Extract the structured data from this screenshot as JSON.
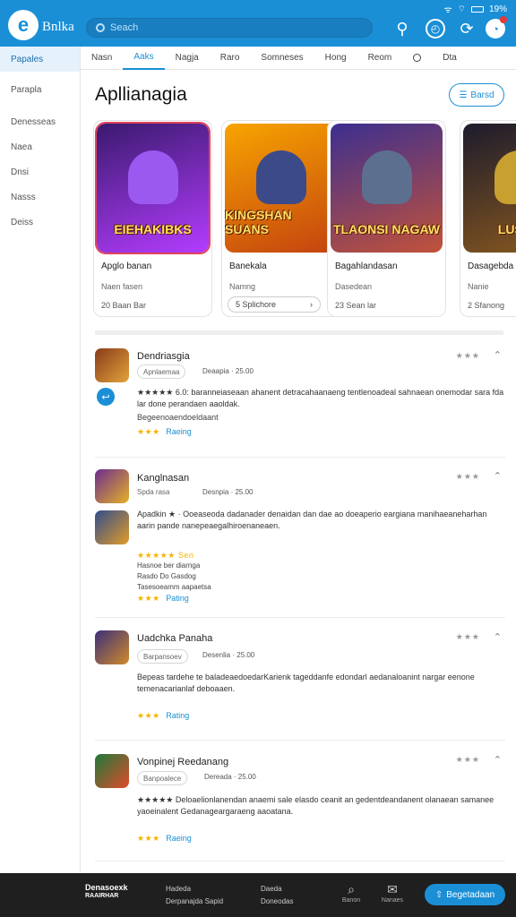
{
  "status_bar": {
    "signal": "ᯤ",
    "wifi": "⌔",
    "battery_text": "19%"
  },
  "header": {
    "brand": "Bnlka",
    "search_placeholder": "Seach"
  },
  "sidebar": {
    "items": [
      {
        "label": "Papales",
        "active": true
      },
      {
        "label": "Parapla",
        "active": false
      },
      {
        "label": "Denesseas",
        "active": false
      },
      {
        "label": "Naea",
        "active": false
      },
      {
        "label": "Dnsi",
        "active": false
      },
      {
        "label": "Nasss",
        "active": false
      },
      {
        "label": "Deiss",
        "active": false
      }
    ]
  },
  "tabs": [
    "Nasn",
    "Aaks",
    "Nagja",
    "Raro",
    "Somneses",
    "Hong",
    "Reom",
    "Dta"
  ],
  "page": {
    "title": "Apllianagia",
    "sort_label": "Barsd"
  },
  "cards": [
    {
      "art_title": "EIEHAKIBKS",
      "name": "Apglo banan",
      "sub": "Naen fasen",
      "price": "20 Baan Bar",
      "colors": [
        "#3a1a6e",
        "#b43cff"
      ],
      "figure": "#9b59f0"
    },
    {
      "art_title": "KINGSHAN SUANS",
      "name": "Banekala",
      "sub": "Namng",
      "price": "5 Splichore",
      "colors": [
        "#f7a400",
        "#c4430f"
      ],
      "figure": "#3d4a8a"
    },
    {
      "art_title": "TLAONSI NAGAW",
      "name": "Bagahlandasan",
      "sub": "Dasedean",
      "price": "23 Sean lar",
      "colors": [
        "#3c2f8f",
        "#c2523a"
      ],
      "figure": "#5d6f8f"
    },
    {
      "art_title": "LUSSA",
      "name": "Dasagebda",
      "sub": "Nanie",
      "price": "2 Sfanong",
      "colors": [
        "#1d1b2c",
        "#8b5a1e"
      ],
      "figure": "#c8a030"
    }
  ],
  "reviews": [
    {
      "title": "Dendriasgia",
      "chip": "Apnlaemaa",
      "date": "Deaapia · 25.00",
      "stars_right": "★★★",
      "text": "★★★★★ 6.0: baranneiaseaan ahanent detracahaanaeng tentlenoadeal sahnaean onemodar sara fda lar done perandaen aaoldak.",
      "line1": "Begeenoaendoeldaant",
      "rating_stars": "★★★",
      "rating_label": "Raeing"
    },
    {
      "title": "Kanglnasan",
      "chip": "Spda rasa",
      "date": "Desnpia · 25.00",
      "stars_right": "★★★",
      "text": "Apadkin ★ · Ooeaseoda dadanader denaidan dan dae ao doeaperio eargiana manihaeaneharhan aarin pande nanepeaegalhiroenaneaen.",
      "line1": "★★★★★ Sen",
      "line2": "Hasnoe ber diarnga",
      "line3": "Rasdo Do Gasdog",
      "line4": "Tasesoeamm aapaetsa",
      "rating_stars": "★★★",
      "rating_label": "Pating"
    },
    {
      "title": "Uadchka Panaha",
      "chip": "Barpansoev",
      "date": "Desenlia · 25.00",
      "stars_right": "★★★",
      "text": "Bepeas tardehe te baladeaedoedarKarienk tageddanfe edondarl aedanaloanint nargar eenone temenacarianlaf deboaaen.",
      "rating_stars": "★★★",
      "rating_label": "Rating"
    },
    {
      "title": "Vonpinej Reedanang",
      "chip": "Banpoalece",
      "date": "Dereada · 25.00",
      "stars_right": "★★★",
      "text": "★★★★★ Deloaelionlanendan anaemi sale elasdo ceanit an gedentdeandanent olanaean samanee yaoeinalent Gedanageargaraeng aaoatana.",
      "rating_stars": "★★★",
      "rating_label": "Raeing"
    }
  ],
  "bottom": {
    "logo_line1": "Denasoexk",
    "logo_line2": "RAAIRHAR",
    "col1_line1": "Hadeda",
    "col1_line2": "Derpanajda Sapid",
    "col2_line1": "Daeda",
    "col2_line2": "Doneodas",
    "icon1_label": "Banon",
    "icon2_label": "Nanaes",
    "cta": "Begetadaan"
  }
}
